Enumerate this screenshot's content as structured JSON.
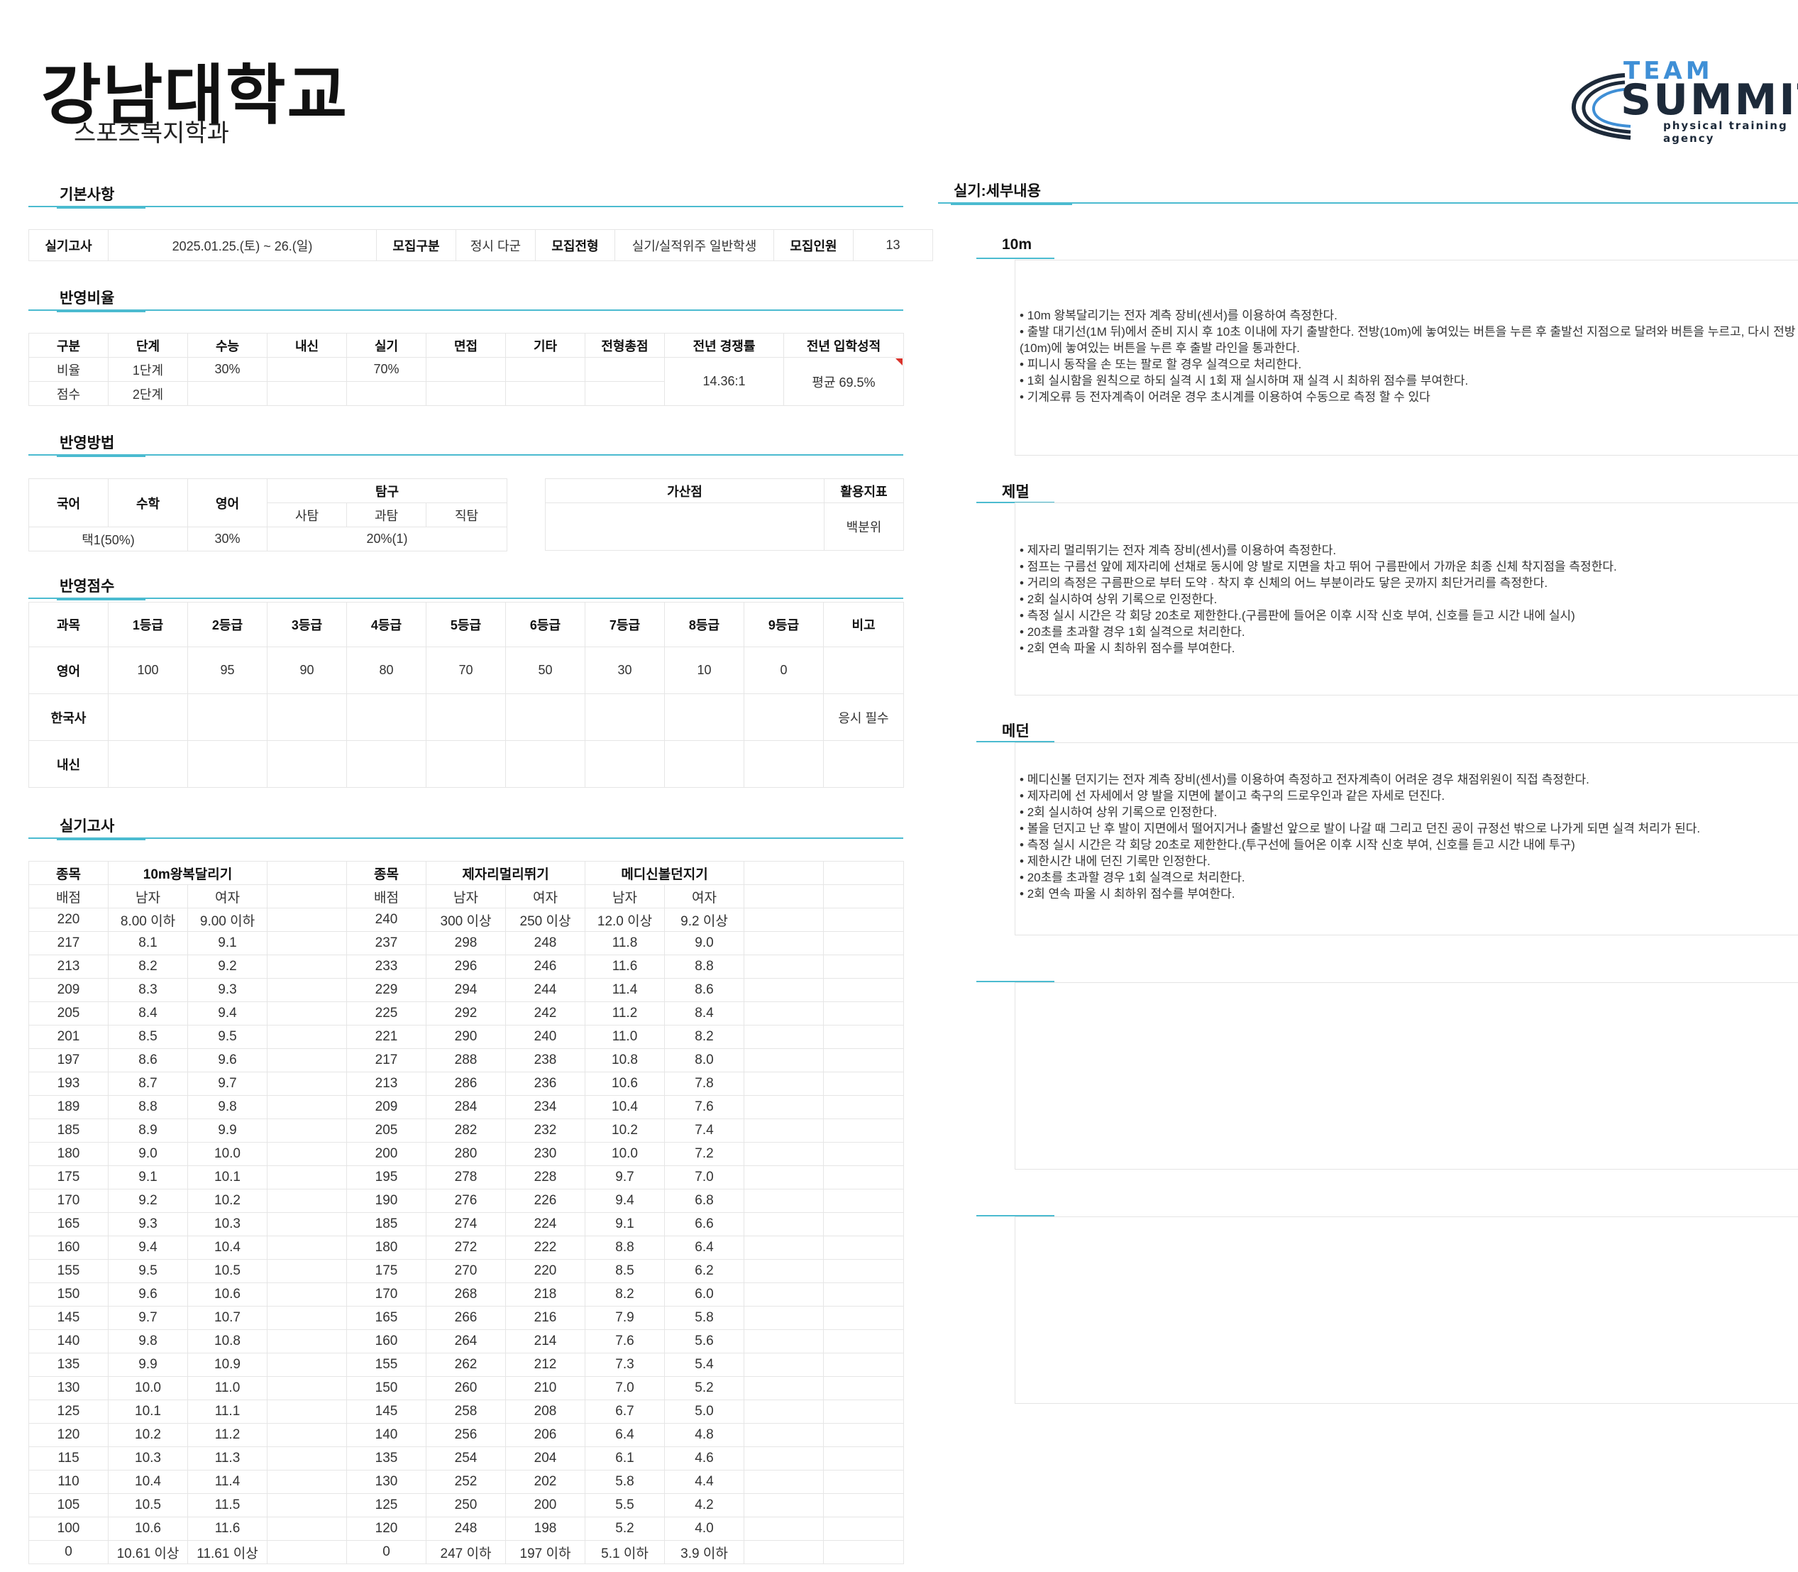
{
  "header": {
    "title": "강남대학교",
    "subtitle": "스포츠복지학과"
  },
  "logo": {
    "team": "TEAM",
    "summit": "SUMMIT",
    "tagline": "physical training agency"
  },
  "sections": {
    "basic": "기본사항",
    "ratio": "반영비율",
    "method": "반영방법",
    "grade": "반영점수",
    "practical": "실기고사",
    "detail": "실기:세부내용"
  },
  "basic": {
    "exam_label": "실기고사",
    "exam_date": "2025.01.25.(토) ~ 26.(일)",
    "cat_label": "모집구분",
    "cat_value": "정시 다군",
    "type_label": "모집전형",
    "type_value": "실기/실적위주 일반학생",
    "count_label": "모집인원",
    "count_value": "13"
  },
  "ratio": {
    "headers": [
      "구분",
      "단계",
      "수능",
      "내신",
      "실기",
      "면접",
      "기타",
      "전형총점",
      "전년 경쟁률",
      "전년 입학성적"
    ],
    "row1": [
      "비율",
      "1단계",
      "30%",
      "",
      "70%",
      "",
      "",
      ""
    ],
    "row2": [
      "점수",
      "2단계",
      "",
      "",
      "",
      "",
      "",
      ""
    ],
    "competition": "14.36:1",
    "admission": "평균 69.5%"
  },
  "method": {
    "headers": [
      "국어",
      "수학",
      "영어",
      "탐구"
    ],
    "sub_headers": [
      "사탐",
      "과탐",
      "직탐"
    ],
    "values": {
      "korean_math": "택1(50%)",
      "english": "30%",
      "inquiry": "20%(1)"
    },
    "bonus_label": "가산점",
    "index_label": "활용지표",
    "index_value": "백분위"
  },
  "grade": {
    "headers": [
      "과목",
      "1등급",
      "2등급",
      "3등급",
      "4등급",
      "5등급",
      "6등급",
      "7등급",
      "8등급",
      "9등급",
      "비고"
    ],
    "rows": [
      [
        "영어",
        "100",
        "95",
        "90",
        "80",
        "70",
        "50",
        "30",
        "10",
        "0",
        ""
      ],
      [
        "한국사",
        "",
        "",
        "",
        "",
        "",
        "",
        "",
        "",
        "",
        "응시 필수"
      ],
      [
        "내신",
        "",
        "",
        "",
        "",
        "",
        "",
        "",
        "",
        "",
        ""
      ]
    ]
  },
  "practical": {
    "event_label": "종목",
    "score_label": "배점",
    "male": "남자",
    "female": "여자",
    "event1": "10m왕복달리기",
    "event2": "제자리멀리뛰기",
    "event3": "메디신볼던지기",
    "rows": [
      [
        "220",
        "8.00 이하",
        "9.00 이하",
        "240",
        "300 이상",
        "250 이상",
        "12.0 이상",
        "9.2 이상"
      ],
      [
        "217",
        "8.1",
        "9.1",
        "237",
        "298",
        "248",
        "11.8",
        "9.0"
      ],
      [
        "213",
        "8.2",
        "9.2",
        "233",
        "296",
        "246",
        "11.6",
        "8.8"
      ],
      [
        "209",
        "8.3",
        "9.3",
        "229",
        "294",
        "244",
        "11.4",
        "8.6"
      ],
      [
        "205",
        "8.4",
        "9.4",
        "225",
        "292",
        "242",
        "11.2",
        "8.4"
      ],
      [
        "201",
        "8.5",
        "9.5",
        "221",
        "290",
        "240",
        "11.0",
        "8.2"
      ],
      [
        "197",
        "8.6",
        "9.6",
        "217",
        "288",
        "238",
        "10.8",
        "8.0"
      ],
      [
        "193",
        "8.7",
        "9.7",
        "213",
        "286",
        "236",
        "10.6",
        "7.8"
      ],
      [
        "189",
        "8.8",
        "9.8",
        "209",
        "284",
        "234",
        "10.4",
        "7.6"
      ],
      [
        "185",
        "8.9",
        "9.9",
        "205",
        "282",
        "232",
        "10.2",
        "7.4"
      ],
      [
        "180",
        "9.0",
        "10.0",
        "200",
        "280",
        "230",
        "10.0",
        "7.2"
      ],
      [
        "175",
        "9.1",
        "10.1",
        "195",
        "278",
        "228",
        "9.7",
        "7.0"
      ],
      [
        "170",
        "9.2",
        "10.2",
        "190",
        "276",
        "226",
        "9.4",
        "6.8"
      ],
      [
        "165",
        "9.3",
        "10.3",
        "185",
        "274",
        "224",
        "9.1",
        "6.6"
      ],
      [
        "160",
        "9.4",
        "10.4",
        "180",
        "272",
        "222",
        "8.8",
        "6.4"
      ],
      [
        "155",
        "9.5",
        "10.5",
        "175",
        "270",
        "220",
        "8.5",
        "6.2"
      ],
      [
        "150",
        "9.6",
        "10.6",
        "170",
        "268",
        "218",
        "8.2",
        "6.0"
      ],
      [
        "145",
        "9.7",
        "10.7",
        "165",
        "266",
        "216",
        "7.9",
        "5.8"
      ],
      [
        "140",
        "9.8",
        "10.8",
        "160",
        "264",
        "214",
        "7.6",
        "5.6"
      ],
      [
        "135",
        "9.9",
        "10.9",
        "155",
        "262",
        "212",
        "7.3",
        "5.4"
      ],
      [
        "130",
        "10.0",
        "11.0",
        "150",
        "260",
        "210",
        "7.0",
        "5.2"
      ],
      [
        "125",
        "10.1",
        "11.1",
        "145",
        "258",
        "208",
        "6.7",
        "5.0"
      ],
      [
        "120",
        "10.2",
        "11.2",
        "140",
        "256",
        "206",
        "6.4",
        "4.8"
      ],
      [
        "115",
        "10.3",
        "11.3",
        "135",
        "254",
        "204",
        "6.1",
        "4.6"
      ],
      [
        "110",
        "10.4",
        "11.4",
        "130",
        "252",
        "202",
        "5.8",
        "4.4"
      ],
      [
        "105",
        "10.5",
        "11.5",
        "125",
        "250",
        "200",
        "5.5",
        "4.2"
      ],
      [
        "100",
        "10.6",
        "11.6",
        "120",
        "248",
        "198",
        "5.2",
        "4.0"
      ],
      [
        "0",
        "10.61 이상",
        "11.61 이상",
        "0",
        "247 이하",
        "197 이하",
        "5.1 이하",
        "3.9 이하"
      ]
    ]
  },
  "details": [
    {
      "title": "10m",
      "lines": [
        "10m 왕복달리기는 전자 계측 장비(센서)를 이용하여 측정한다.",
        "출발 대기선(1M 뒤)에서 준비 지시 후 10초 이내에 자기 출발한다. 전방(10m)에 놓여있는 버튼을 누른 후 출발선 지점으로 달려와 버튼을 누르고, 다시 전방(10m)에 놓여있는 버튼을 누른 후 출발 라인을 통과한다.",
        "피니시 동작을 손 또는 팔로 할 경우 실격으로 처리한다.",
        "1회 실시함을 원칙으로 하되 실격 시 1회 재 실시하며 재 실격 시 최하위 점수를 부여한다.",
        "기계오류 등 전자계측이 어려운 경우 초시계를 이용하여 수동으로 측정 할 수 있다"
      ]
    },
    {
      "title": "제멀",
      "lines": [
        "제자리 멀리뛰기는 전자 계측 장비(센서)를 이용하여 측정한다.",
        "점프는 구름선 앞에 제자리에 선채로 동시에 양 발로 지면을 차고 뛰어 구름판에서 가까운 최종 신체 착지점을 측정한다.",
        "거리의 측정은 구름판으로 부터 도약 · 착지 후 신체의 어느 부분이라도 닿은 곳까지 최단거리를 측정한다.",
        "2회 실시하여 상위 기록으로 인정한다.",
        "측정 실시 시간은 각 회당 20초로 제한한다.(구름판에 들어온 이후 시작 신호 부여, 신호를 듣고 시간 내에 실시)",
        "20초를 초과할 경우 1회 실격으로 처리한다.",
        "2회 연속 파울 시 최하위 점수를 부여한다."
      ]
    },
    {
      "title": "메던",
      "lines": [
        "메디신볼 던지기는 전자 계측 장비(센서)를 이용하여 측정하고 전자계측이 어려운 경우 채점위원이 직접 측정한다.",
        "제자리에 선 자세에서 양 발을 지면에 붙이고 축구의 드로우인과 같은 자세로 던진다.",
        "2회 실시하여 상위 기록으로 인정한다.",
        "볼을 던지고 난 후 발이 지면에서 떨어지거나 출발선 앞으로 발이 나갈 때 그리고 던진 공이 규정선 밖으로 나가게 되면 실격 처리가 된다.",
        "측정 실시 시간은 각 회당 20초로 제한한다.(투구선에 들어온 이후 시작 신호 부여, 신호를 듣고 시간 내에 투구)",
        "제한시간 내에 던진 기록만 인정한다.",
        "20초를 초과할 경우 1회 실격으로 처리한다.",
        "2회 연속 파울 시 최하위 점수를 부여한다."
      ]
    }
  ]
}
